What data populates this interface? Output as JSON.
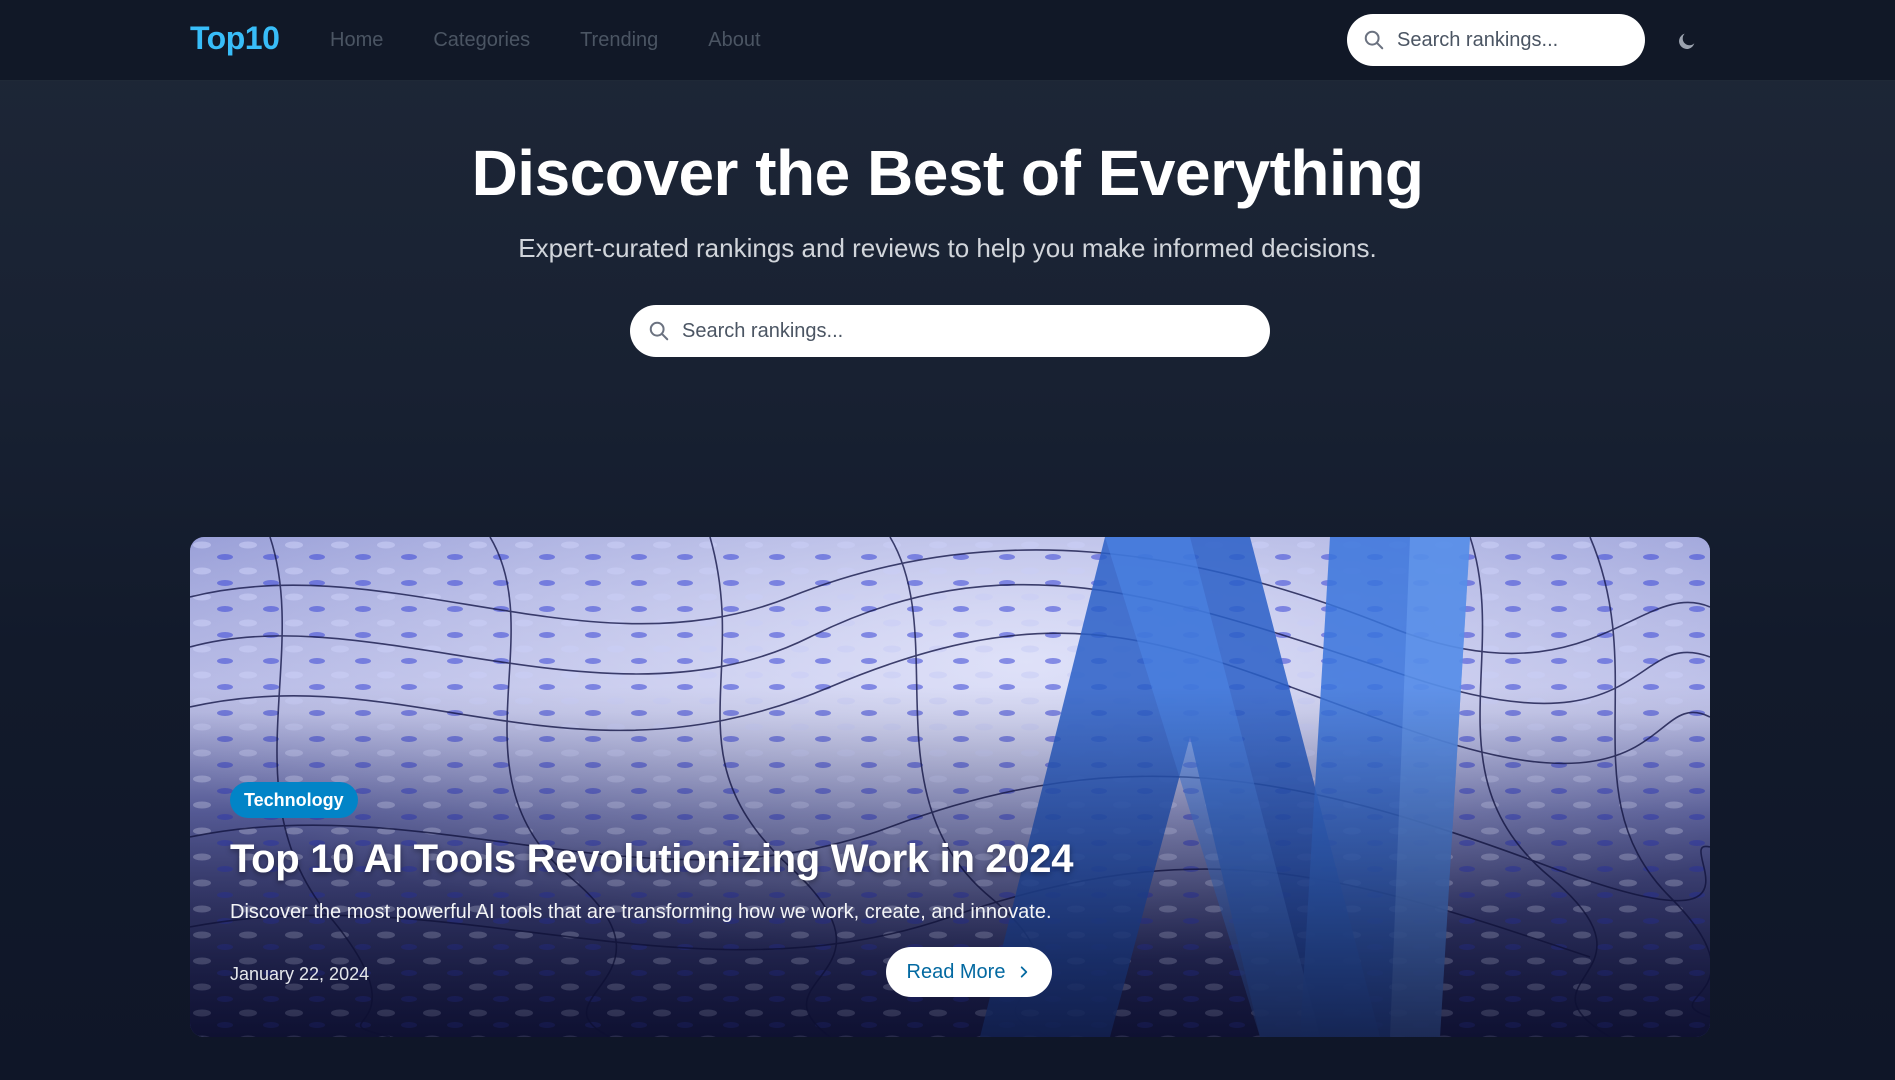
{
  "brand": {
    "logo_text": "Top10",
    "accent_color": "#38bdf8"
  },
  "nav": {
    "links": [
      {
        "label": "Home"
      },
      {
        "label": "Categories"
      },
      {
        "label": "Trending"
      },
      {
        "label": "About"
      }
    ],
    "search_placeholder": "Search rankings...",
    "theme_toggle_icon": "moon-icon"
  },
  "hero": {
    "title": "Discover the Best of Everything",
    "subtitle": "Expert-curated rankings and reviews to help you make informed decisions.",
    "search_placeholder": "Search rankings..."
  },
  "featured": {
    "category": "Technology",
    "title": "Top 10 AI Tools Revolutionizing Work in 2024",
    "description": "Discover the most powerful AI tools that are transforming how we work, create, and innovate.",
    "date": "January 22, 2024",
    "cta_label": "Read More",
    "cta_icon": "chevron-right-icon",
    "tag_color": "#0284c7"
  }
}
